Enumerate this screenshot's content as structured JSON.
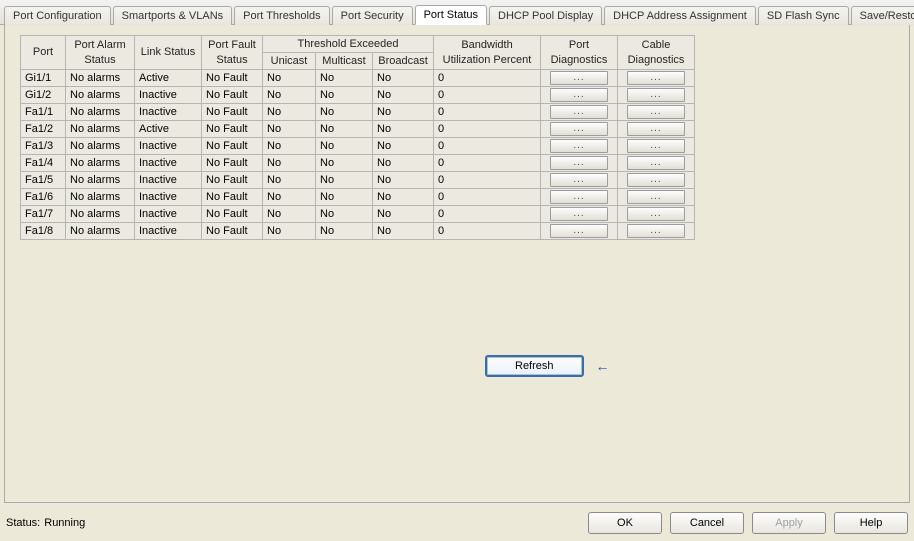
{
  "tabs": [
    {
      "label": "Port Configuration",
      "active": false
    },
    {
      "label": "Smartports & VLANs",
      "active": false
    },
    {
      "label": "Port Thresholds",
      "active": false
    },
    {
      "label": "Port Security",
      "active": false
    },
    {
      "label": "Port Status",
      "active": true
    },
    {
      "label": "DHCP Pool Display",
      "active": false
    },
    {
      "label": "DHCP Address Assignment",
      "active": false
    },
    {
      "label": "SD Flash Sync",
      "active": false
    },
    {
      "label": "Save/Restore",
      "active": false
    }
  ],
  "tab_scroll": {
    "left": "◄",
    "right": "►"
  },
  "table": {
    "headers": {
      "port": "Port",
      "alarm_l1": "Port Alarm",
      "alarm_l2": "Status",
      "link": "Link Status",
      "fault_l1": "Port Fault",
      "fault_l2": "Status",
      "threshold": "Threshold Exceeded",
      "unicast": "Unicast",
      "multicast": "Multicast",
      "broadcast": "Broadcast",
      "bw_l1": "Bandwidth",
      "bw_l2": "Utilization Percent",
      "pdiag_l1": "Port",
      "pdiag_l2": "Diagnostics",
      "cdiag_l1": "Cable",
      "cdiag_l2": "Diagnostics"
    },
    "rows": [
      {
        "port": "Gi1/1",
        "alarm": "No alarms",
        "link": "Active",
        "fault": "No Fault",
        "uni": "No",
        "multi": "No",
        "broad": "No",
        "bw": "0"
      },
      {
        "port": "Gi1/2",
        "alarm": "No alarms",
        "link": "Inactive",
        "fault": "No Fault",
        "uni": "No",
        "multi": "No",
        "broad": "No",
        "bw": "0"
      },
      {
        "port": "Fa1/1",
        "alarm": "No alarms",
        "link": "Inactive",
        "fault": "No Fault",
        "uni": "No",
        "multi": "No",
        "broad": "No",
        "bw": "0"
      },
      {
        "port": "Fa1/2",
        "alarm": "No alarms",
        "link": "Active",
        "fault": "No Fault",
        "uni": "No",
        "multi": "No",
        "broad": "No",
        "bw": "0"
      },
      {
        "port": "Fa1/3",
        "alarm": "No alarms",
        "link": "Inactive",
        "fault": "No Fault",
        "uni": "No",
        "multi": "No",
        "broad": "No",
        "bw": "0"
      },
      {
        "port": "Fa1/4",
        "alarm": "No alarms",
        "link": "Inactive",
        "fault": "No Fault",
        "uni": "No",
        "multi": "No",
        "broad": "No",
        "bw": "0"
      },
      {
        "port": "Fa1/5",
        "alarm": "No alarms",
        "link": "Inactive",
        "fault": "No Fault",
        "uni": "No",
        "multi": "No",
        "broad": "No",
        "bw": "0"
      },
      {
        "port": "Fa1/6",
        "alarm": "No alarms",
        "link": "Inactive",
        "fault": "No Fault",
        "uni": "No",
        "multi": "No",
        "broad": "No",
        "bw": "0"
      },
      {
        "port": "Fa1/7",
        "alarm": "No alarms",
        "link": "Inactive",
        "fault": "No Fault",
        "uni": "No",
        "multi": "No",
        "broad": "No",
        "bw": "0"
      },
      {
        "port": "Fa1/8",
        "alarm": "No alarms",
        "link": "Inactive",
        "fault": "No Fault",
        "uni": "No",
        "multi": "No",
        "broad": "No",
        "bw": "0"
      }
    ],
    "cell_button_label": "..."
  },
  "refresh_label": "Refresh",
  "status_prefix": "Status:",
  "status_value": "Running",
  "footer": {
    "ok": "OK",
    "cancel": "Cancel",
    "apply": "Apply",
    "help": "Help"
  }
}
